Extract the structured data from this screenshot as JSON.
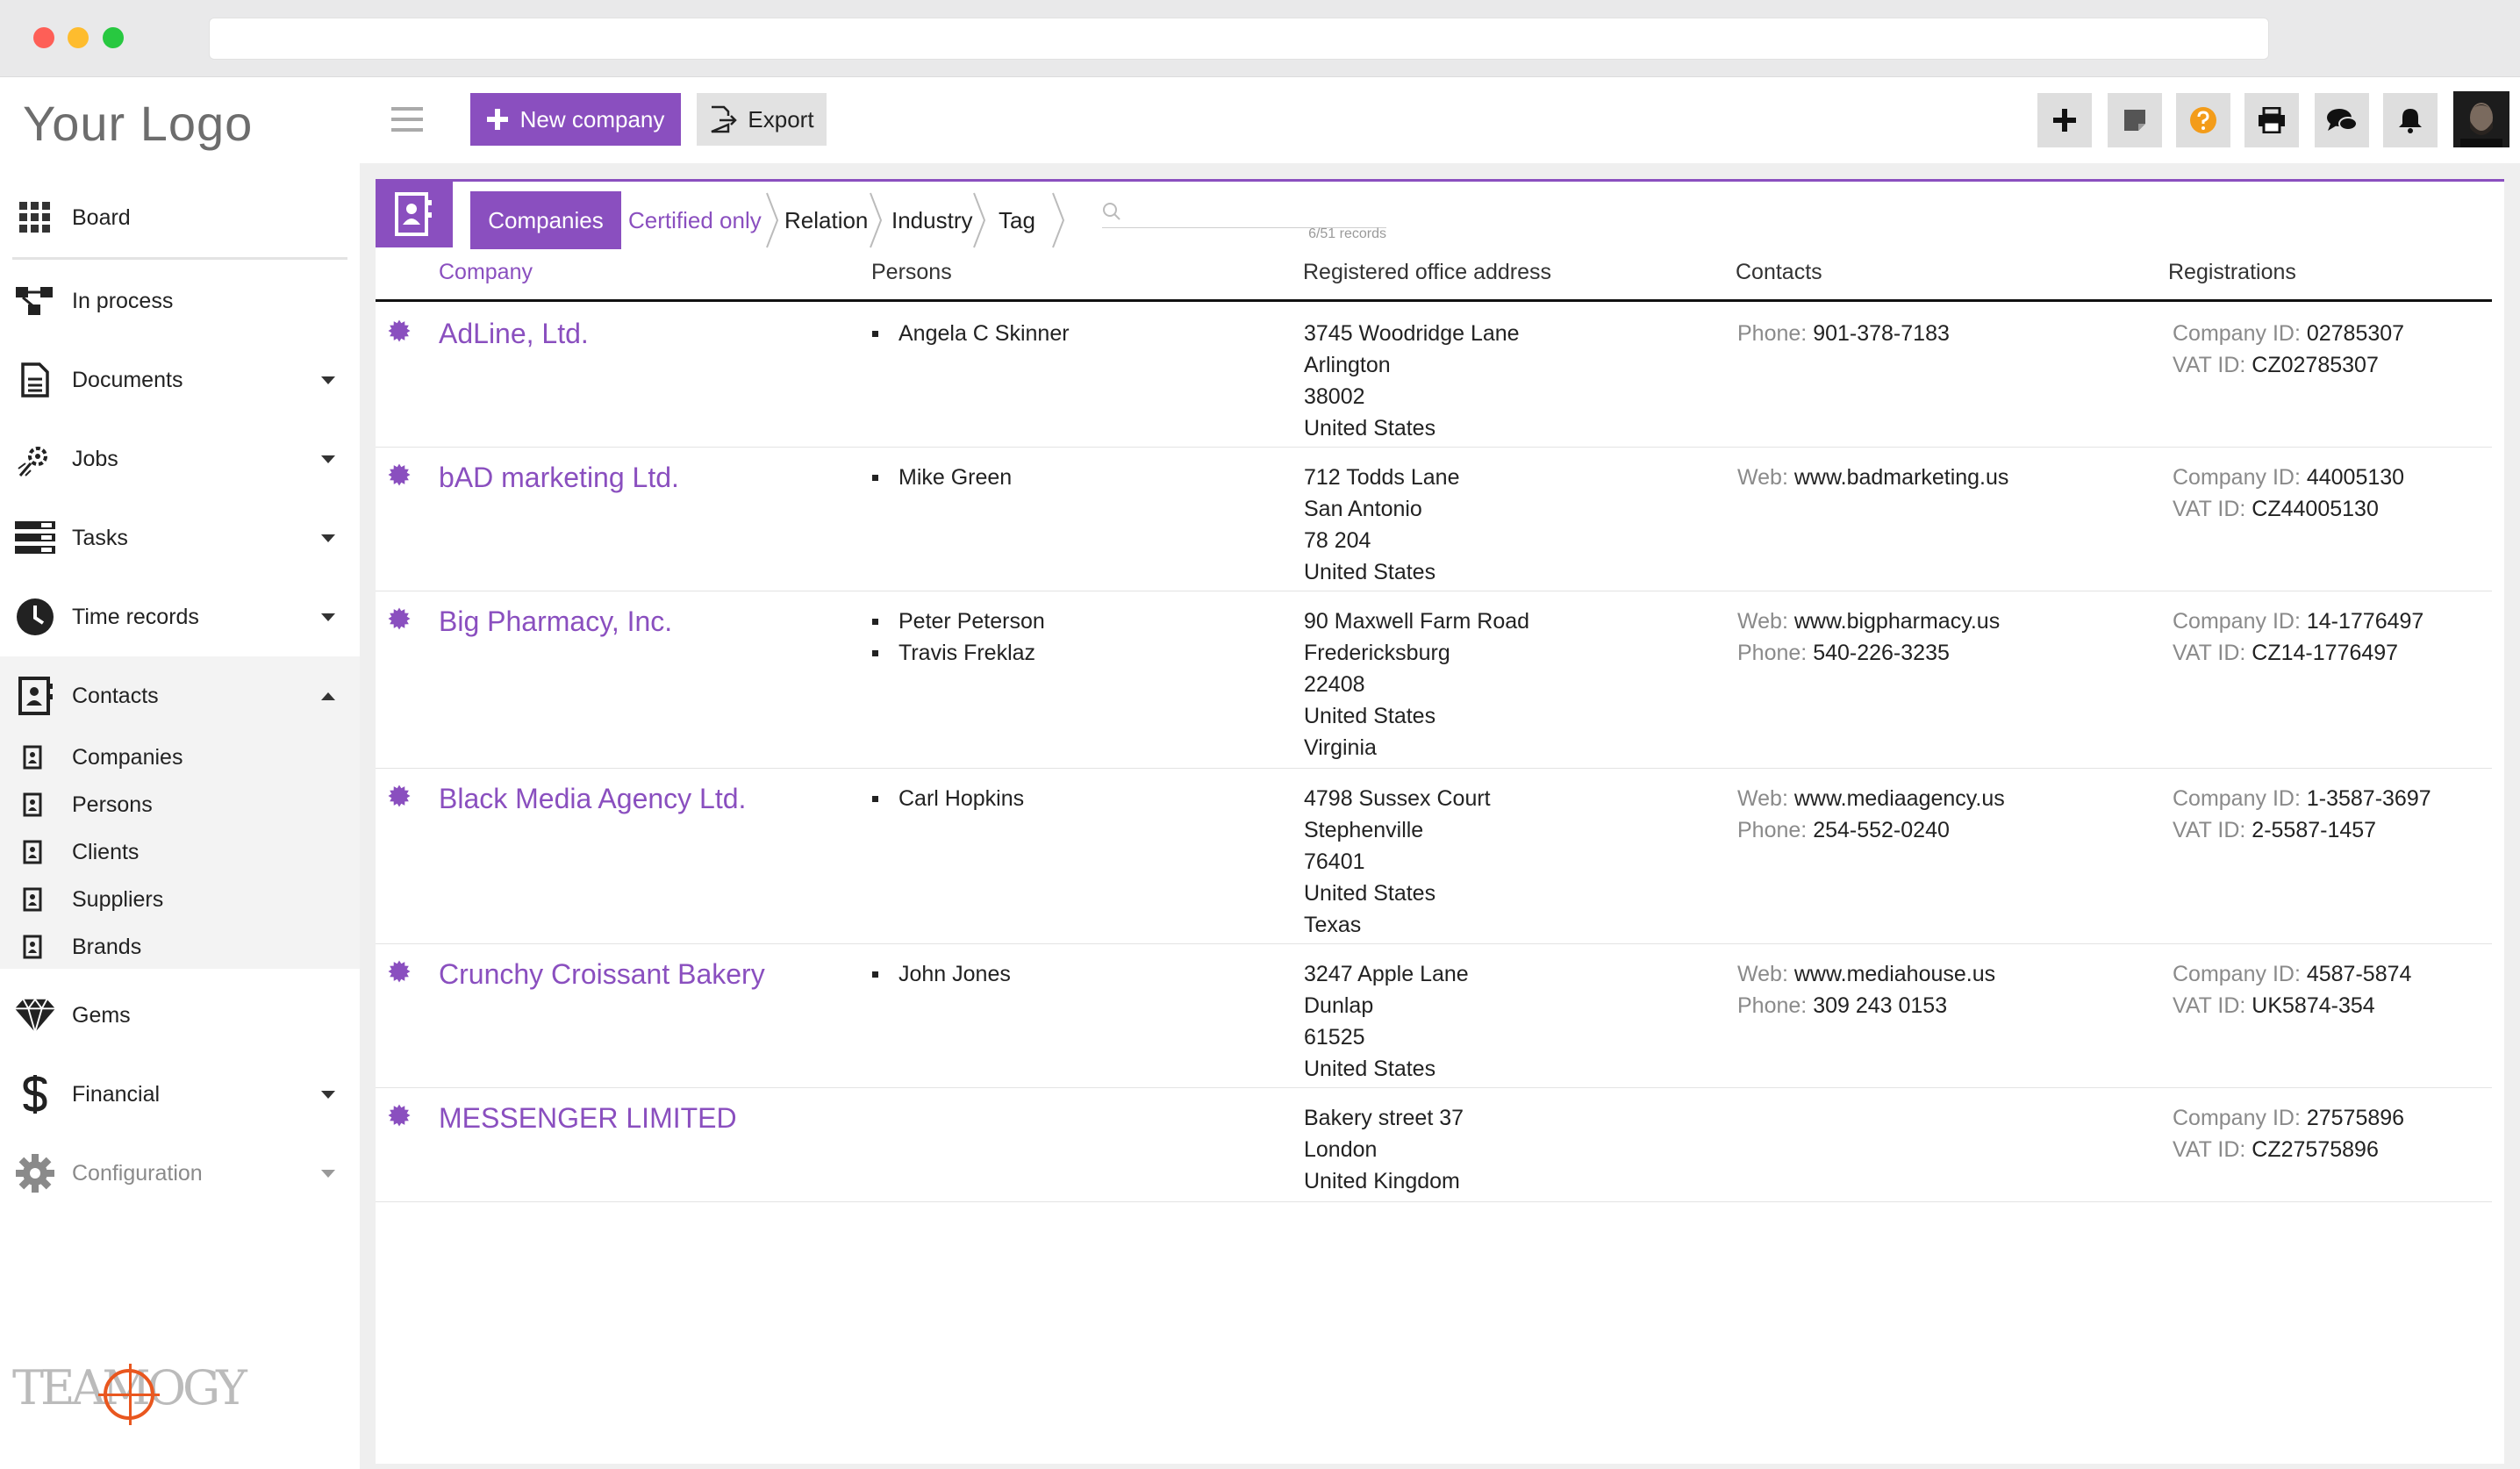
{
  "app": {
    "logo_text": "Your Logo",
    "brand_text": "TEAMOGY"
  },
  "sidebar": {
    "items": [
      {
        "label": "Board",
        "icon": "grid-icon"
      },
      {
        "label": "In process",
        "icon": "flow-icon"
      },
      {
        "label": "Documents",
        "icon": "document-icon"
      },
      {
        "label": "Jobs",
        "icon": "jobs-icon"
      },
      {
        "label": "Tasks",
        "icon": "tasks-icon"
      },
      {
        "label": "Time records",
        "icon": "clock-icon"
      },
      {
        "label": "Contacts",
        "icon": "contacts-icon"
      },
      {
        "label": "Gems",
        "icon": "gem-icon"
      },
      {
        "label": "Financial",
        "icon": "dollar-icon"
      },
      {
        "label": "Configuration",
        "icon": "gear-icon"
      }
    ],
    "sub_items": [
      {
        "label": "Companies"
      },
      {
        "label": "Persons"
      },
      {
        "label": "Clients"
      },
      {
        "label": "Suppliers"
      },
      {
        "label": "Brands"
      }
    ]
  },
  "toolbar": {
    "new_label": "New company",
    "export_label": "Export"
  },
  "tabs": {
    "companies": "Companies",
    "certified": "Certified only",
    "relation": "Relation",
    "industry": "Industry",
    "tag": "Tag"
  },
  "search": {
    "records": "6/51 records"
  },
  "table": {
    "headers": {
      "company": "Company",
      "persons": "Persons",
      "address": "Registered office address",
      "contacts": "Contacts",
      "registrations": "Registrations"
    },
    "rows": [
      {
        "name": "AdLine, Ltd.",
        "persons": [
          "Angela C Skinner"
        ],
        "address": [
          "3745 Woodridge Lane",
          "Arlington",
          "38002",
          "United States"
        ],
        "contacts": [
          {
            "k": "Phone:",
            "v": "901-378-7183"
          }
        ],
        "regs": [
          {
            "k": "Company ID:",
            "v": "02785307"
          },
          {
            "k": "VAT ID:",
            "v": "CZ02785307"
          }
        ]
      },
      {
        "name": "bAD marketing Ltd.",
        "persons": [
          "Mike Green"
        ],
        "address": [
          "712 Todds Lane",
          "San Antonio",
          "78 204",
          "United States"
        ],
        "contacts": [
          {
            "k": "Web:",
            "v": "www.badmarketing.us"
          }
        ],
        "regs": [
          {
            "k": "Company ID:",
            "v": "44005130"
          },
          {
            "k": "VAT ID:",
            "v": "CZ44005130"
          }
        ]
      },
      {
        "name": "Big Pharmacy, Inc.",
        "persons": [
          "Peter Peterson",
          "Travis Freklaz"
        ],
        "address": [
          "90 Maxwell Farm Road",
          "Fredericksburg",
          "22408",
          "United States",
          "Virginia"
        ],
        "contacts": [
          {
            "k": "Web:",
            "v": "www.bigpharmacy.us"
          },
          {
            "k": "Phone:",
            "v": "540-226-3235"
          }
        ],
        "regs": [
          {
            "k": "Company ID:",
            "v": "14-1776497"
          },
          {
            "k": "VAT ID:",
            "v": "CZ14-1776497"
          }
        ]
      },
      {
        "name": "Black Media Agency Ltd.",
        "persons": [
          "Carl Hopkins"
        ],
        "address": [
          "4798 Sussex Court",
          "Stephenville",
          "76401",
          "United States",
          "Texas"
        ],
        "contacts": [
          {
            "k": "Web:",
            "v": "www.mediaagency.us"
          },
          {
            "k": "Phone:",
            "v": "254-552-0240"
          }
        ],
        "regs": [
          {
            "k": "Company ID:",
            "v": "1-3587-3697"
          },
          {
            "k": "VAT ID:",
            "v": "2-5587-1457"
          }
        ]
      },
      {
        "name": "Crunchy Croissant Bakery",
        "persons": [
          "John Jones"
        ],
        "address": [
          "3247 Apple Lane",
          "Dunlap",
          "61525",
          "United States"
        ],
        "contacts": [
          {
            "k": "Web:",
            "v": "www.mediahouse.us"
          },
          {
            "k": "Phone:",
            "v": "309 243 0153"
          }
        ],
        "regs": [
          {
            "k": "Company ID:",
            "v": "4587-5874"
          },
          {
            "k": "VAT ID:",
            "v": "UK5874-354"
          }
        ]
      },
      {
        "name": "MESSENGER LIMITED",
        "persons": [],
        "address": [
          "Bakery street 37",
          "London",
          "United Kingdom"
        ],
        "contacts": [],
        "regs": [
          {
            "k": "Company ID:",
            "v": "27575896"
          },
          {
            "k": "VAT ID:",
            "v": "CZ27575896"
          }
        ]
      }
    ]
  },
  "colors": {
    "accent": "#8a4fbf",
    "help": "#f39c1a"
  }
}
